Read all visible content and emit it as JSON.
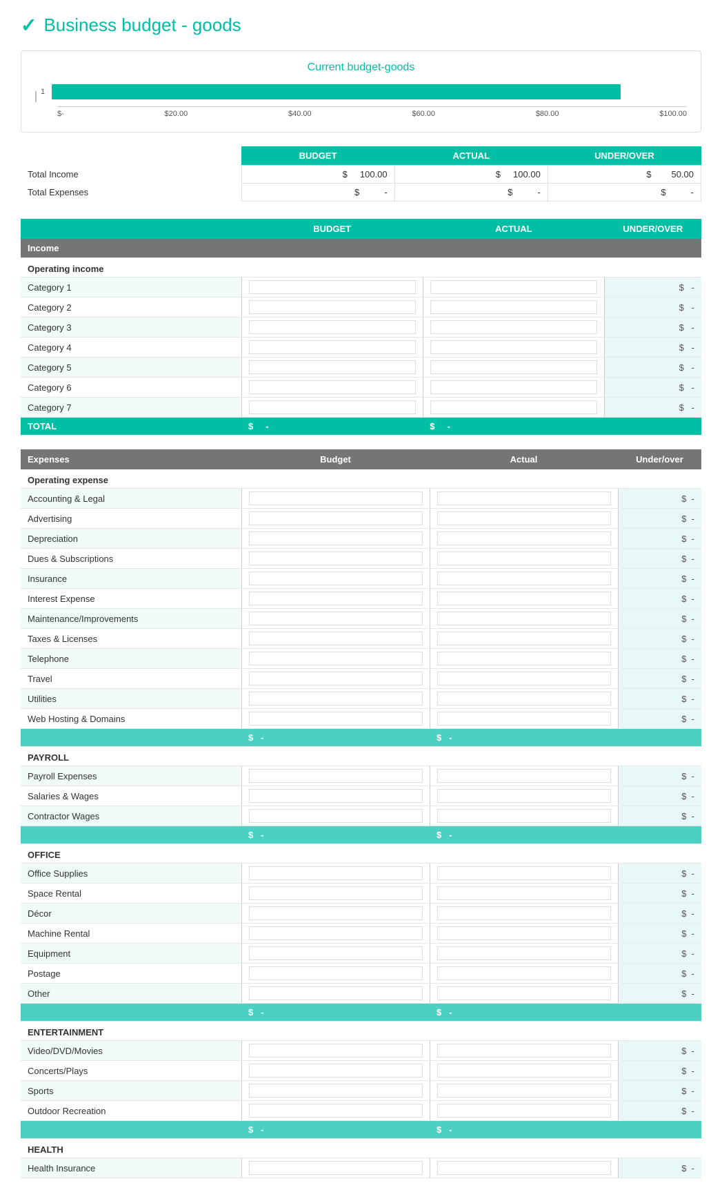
{
  "title": "Business budget - goods",
  "chart": {
    "title": "Current budget-goods",
    "bars": [
      {
        "label": "1",
        "width": 88
      }
    ],
    "xAxis": [
      "$-",
      "$20.00",
      "$40.00",
      "$60.00",
      "$80.00",
      "$100.00"
    ]
  },
  "summary": {
    "headers": [
      "BUDGET",
      "ACTUAL",
      "UNDER/OVER"
    ],
    "rows": [
      {
        "label": "Total Income",
        "budget": "$ 100.00",
        "actual": "$ 100.00",
        "underover": "$ 50.00"
      },
      {
        "label": "Total Expenses",
        "budget": "$  -",
        "actual": "$  -",
        "underover": "$  -"
      }
    ]
  },
  "mainTable": {
    "headers": [
      "",
      "BUDGET",
      "ACTUAL",
      "UNDER/OVER"
    ],
    "income": {
      "sectionLabel": "Income",
      "subsectionLabel": "Operating income",
      "categories": [
        "Category 1",
        "Category 2",
        "Category 3",
        "Category 4",
        "Category 5",
        "Category 6",
        "Category 7"
      ],
      "totalLabel": "TOTAL"
    },
    "expenses": {
      "sectionLabel": "Expenses",
      "budgetHeader": "Budget",
      "actualHeader": "Actual",
      "underoverHeader": "Under/over",
      "groups": [
        {
          "groupLabel": "Operating expense",
          "items": [
            "Accounting & Legal",
            "Advertising",
            "Depreciation",
            "Dues & Subscriptions",
            "Insurance",
            "Interest Expense",
            "Maintenance/Improvements",
            "Taxes & Licenses",
            "Telephone",
            "Travel",
            "Utilities",
            "Web Hosting & Domains"
          ]
        },
        {
          "groupLabel": "PAYROLL",
          "items": [
            "Payroll Expenses",
            "Salaries & Wages",
            "Contractor Wages"
          ]
        },
        {
          "groupLabel": "OFFICE",
          "items": [
            "Office Supplies",
            "Space Rental",
            "Décor",
            "Machine Rental",
            "Equipment",
            "Postage",
            "Other"
          ]
        },
        {
          "groupLabel": "ENTERTAINMENT",
          "items": [
            "Video/DVD/Movies",
            "Concerts/Plays",
            "Sports",
            "Outdoor Recreation"
          ]
        },
        {
          "groupLabel": "HEALTH",
          "items": [
            "Health Insurance"
          ]
        }
      ]
    }
  },
  "colors": {
    "teal": "#00bfa5",
    "gray": "#757575",
    "lightTeal": "#e0f5f3"
  }
}
